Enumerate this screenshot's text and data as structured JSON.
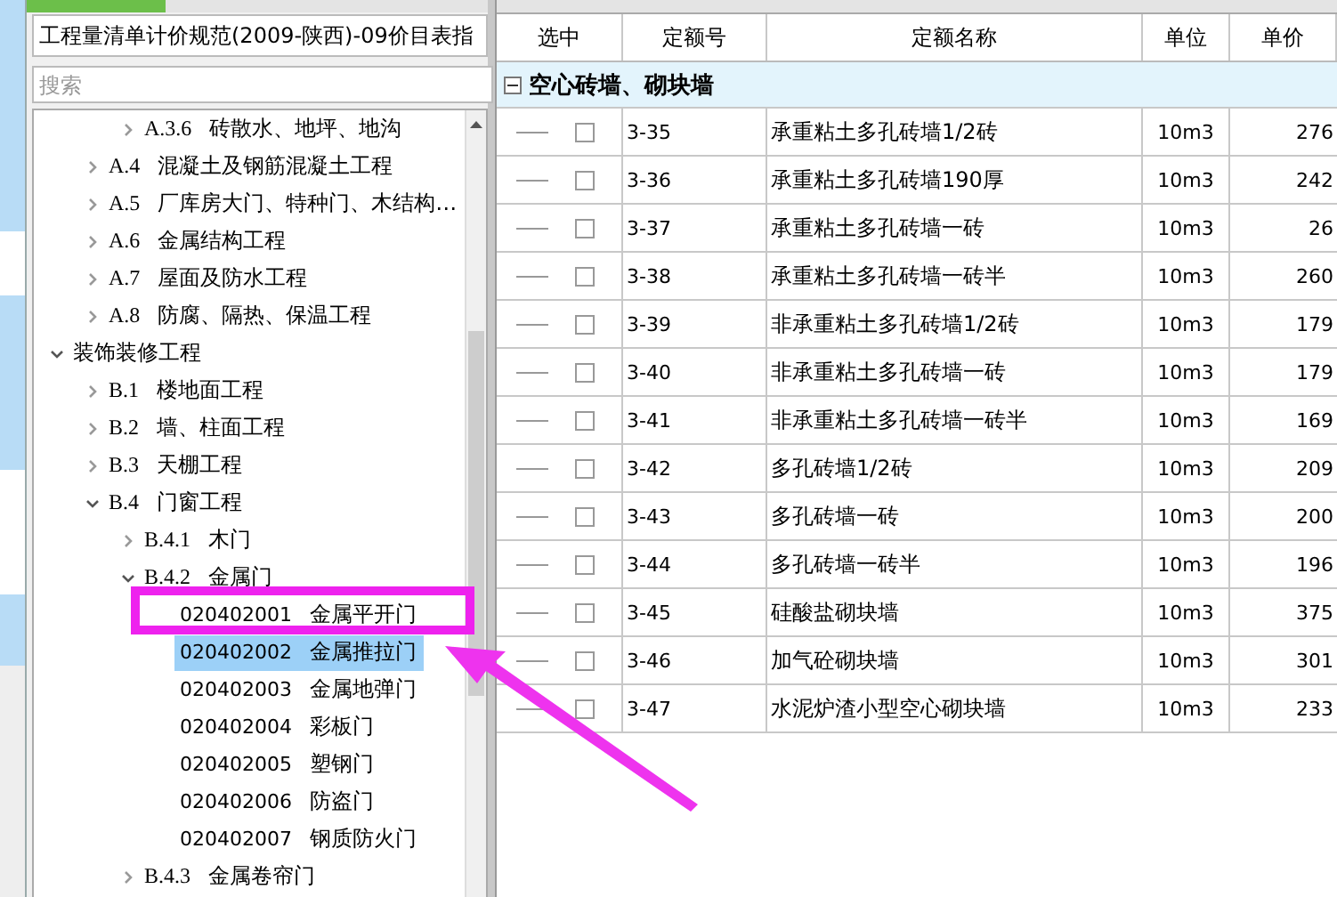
{
  "library_selector": {
    "value": "工程量清单计价规范(2009-陕西)-09价目表指"
  },
  "search": {
    "placeholder": "搜索"
  },
  "tree": [
    {
      "kind": "hidden",
      "children": [
        {
          "kind": "hidden",
          "children": [
            {
              "kind": "branch",
              "expanded": false,
              "selected": false,
              "code": "A.3.6",
              "label": "砖散水、地坪、地沟"
            }
          ]
        },
        {
          "kind": "branch",
          "expanded": false,
          "selected": false,
          "code": "A.4",
          "label": "混凝土及钢筋混凝土工程"
        },
        {
          "kind": "branch",
          "expanded": false,
          "selected": false,
          "code": "A.5",
          "label": "厂库房大门、特种门、木结构…"
        },
        {
          "kind": "branch",
          "expanded": false,
          "selected": false,
          "code": "A.6",
          "label": "金属结构工程"
        },
        {
          "kind": "branch",
          "expanded": false,
          "selected": false,
          "code": "A.7",
          "label": "屋面及防水工程"
        },
        {
          "kind": "branch",
          "expanded": false,
          "selected": false,
          "code": "A.8",
          "label": "防腐、隔热、保温工程"
        }
      ]
    },
    {
      "kind": "branch",
      "expanded": true,
      "selected": false,
      "label": "装饰装修工程",
      "children": [
        {
          "kind": "branch",
          "expanded": false,
          "selected": false,
          "code": "B.1",
          "label": "楼地面工程"
        },
        {
          "kind": "branch",
          "expanded": false,
          "selected": false,
          "code": "B.2",
          "label": "墙、柱面工程"
        },
        {
          "kind": "branch",
          "expanded": false,
          "selected": false,
          "code": "B.3",
          "label": "天棚工程"
        },
        {
          "kind": "branch",
          "expanded": true,
          "selected": false,
          "code": "B.4",
          "label": "门窗工程",
          "children": [
            {
              "kind": "branch",
              "expanded": false,
              "selected": false,
              "code": "B.4.1",
              "label": "木门"
            },
            {
              "kind": "branch",
              "expanded": true,
              "selected": false,
              "code": "B.4.2",
              "label": "金属门",
              "children": [
                {
                  "kind": "leaf",
                  "selected": false,
                  "code": "020402001",
                  "label": "金属平开门"
                },
                {
                  "kind": "leaf",
                  "selected": true,
                  "code": "020402002",
                  "label": "金属推拉门"
                },
                {
                  "kind": "leaf",
                  "selected": false,
                  "code": "020402003",
                  "label": "金属地弹门"
                },
                {
                  "kind": "leaf",
                  "selected": false,
                  "code": "020402004",
                  "label": "彩板门"
                },
                {
                  "kind": "leaf",
                  "selected": false,
                  "code": "020402005",
                  "label": "塑钢门"
                },
                {
                  "kind": "leaf",
                  "selected": false,
                  "code": "020402006",
                  "label": "防盗门"
                },
                {
                  "kind": "leaf",
                  "selected": false,
                  "code": "020402007",
                  "label": "钢质防火门"
                }
              ]
            },
            {
              "kind": "branch",
              "expanded": false,
              "selected": false,
              "code": "B.4.3",
              "label": "金属卷帘门"
            }
          ]
        }
      ]
    }
  ],
  "table": {
    "columns": [
      "选中",
      "定额号",
      "定额名称",
      "单位",
      "单价"
    ],
    "group": {
      "label": "空心砖墙、砌块墙",
      "expanded": true
    },
    "rows": [
      {
        "checked": false,
        "code": "3-35",
        "name": "承重粘土多孔砖墙1/2砖",
        "unit": "10m3",
        "price": "276"
      },
      {
        "checked": false,
        "code": "3-36",
        "name": "承重粘土多孔砖墙190厚",
        "unit": "10m3",
        "price": "242"
      },
      {
        "checked": false,
        "code": "3-37",
        "name": "承重粘土多孔砖墙一砖",
        "unit": "10m3",
        "price": "26"
      },
      {
        "checked": false,
        "code": "3-38",
        "name": "承重粘土多孔砖墙一砖半",
        "unit": "10m3",
        "price": "260"
      },
      {
        "checked": false,
        "code": "3-39",
        "name": "非承重粘土多孔砖墙1/2砖",
        "unit": "10m3",
        "price": "179"
      },
      {
        "checked": false,
        "code": "3-40",
        "name": "非承重粘土多孔砖墙一砖",
        "unit": "10m3",
        "price": "179"
      },
      {
        "checked": false,
        "code": "3-41",
        "name": "非承重粘土多孔砖墙一砖半",
        "unit": "10m3",
        "price": "169"
      },
      {
        "checked": false,
        "code": "3-42",
        "name": "多孔砖墙1/2砖",
        "unit": "10m3",
        "price": "209"
      },
      {
        "checked": false,
        "code": "3-43",
        "name": "多孔砖墙一砖",
        "unit": "10m3",
        "price": "200"
      },
      {
        "checked": false,
        "code": "3-44",
        "name": "多孔砖墙一砖半",
        "unit": "10m3",
        "price": "196"
      },
      {
        "checked": false,
        "code": "3-45",
        "name": "硅酸盐砌块墙",
        "unit": "10m3",
        "price": "375"
      },
      {
        "checked": false,
        "code": "3-46",
        "name": "加气砼砌块墙",
        "unit": "10m3",
        "price": "301"
      },
      {
        "checked": false,
        "code": "3-47",
        "name": "水泥炉渣小型空心砌块墙",
        "unit": "10m3",
        "price": "233"
      }
    ]
  }
}
